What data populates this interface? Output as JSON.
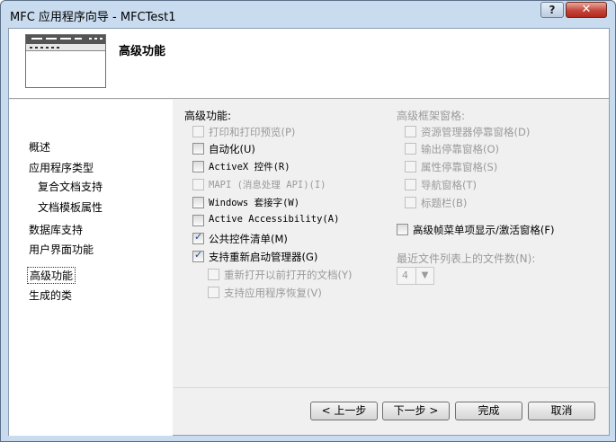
{
  "window": {
    "title": "MFC 应用程序向导 - MFCTest1",
    "help_label": "?",
    "close_label": "✕"
  },
  "header": {
    "title": "高级功能",
    "icon": "window-preview-icon"
  },
  "nav": {
    "items": [
      {
        "label": "概述"
      },
      {
        "label": "应用程序类型"
      },
      {
        "label": "复合文档支持"
      },
      {
        "label": "文档模板属性"
      },
      {
        "label": "数据库支持"
      },
      {
        "label": "用户界面功能"
      },
      {
        "label": "高级功能",
        "selected": true
      },
      {
        "label": "生成的类"
      }
    ]
  },
  "advanced": {
    "label": "高级功能:",
    "options": [
      {
        "label": "打印和打印预览(P)",
        "checked": false,
        "enabled": false
      },
      {
        "label": "自动化(U)",
        "checked": false,
        "enabled": true
      },
      {
        "label": "ActiveX 控件(R)",
        "checked": false,
        "enabled": true
      },
      {
        "label": "MAPI (消息处理 API)(I)",
        "checked": false,
        "enabled": false
      },
      {
        "label": "Windows 套接字(W)",
        "checked": false,
        "enabled": true
      },
      {
        "label": "Active Accessibility(A)",
        "checked": false,
        "enabled": true
      },
      {
        "label": "公共控件清单(M)",
        "checked": true,
        "enabled": true
      },
      {
        "label": "支持重新启动管理器(G)",
        "checked": true,
        "enabled": true
      },
      {
        "label": "重新打开以前打开的文档(Y)",
        "checked": false,
        "enabled": false
      },
      {
        "label": "支持应用程序恢复(V)",
        "checked": false,
        "enabled": false
      }
    ]
  },
  "frame_panes": {
    "label": "高级框架窗格:",
    "options": [
      {
        "label": "资源管理器停靠窗格(D)",
        "checked": false,
        "enabled": false
      },
      {
        "label": "输出停靠窗格(O)",
        "checked": false,
        "enabled": false
      },
      {
        "label": "属性停靠窗格(S)",
        "checked": false,
        "enabled": false
      },
      {
        "label": "导航窗格(T)",
        "checked": false,
        "enabled": false
      },
      {
        "label": "标题栏(B)",
        "checked": false,
        "enabled": false
      }
    ],
    "activate_panes": {
      "label": "高级帧菜单项显示/激活窗格(F)",
      "checked": false,
      "enabled": true
    }
  },
  "mru": {
    "label": "最近文件列表上的文件数(N):",
    "value": "4"
  },
  "buttons": {
    "back": "< 上一步",
    "next": "下一步 >",
    "finish": "完成",
    "cancel": "取消"
  },
  "colors": {
    "titlebar": "#c9dcef",
    "dialog_bg": "#f0f0f0",
    "disabled_text": "#9a9a9a"
  }
}
